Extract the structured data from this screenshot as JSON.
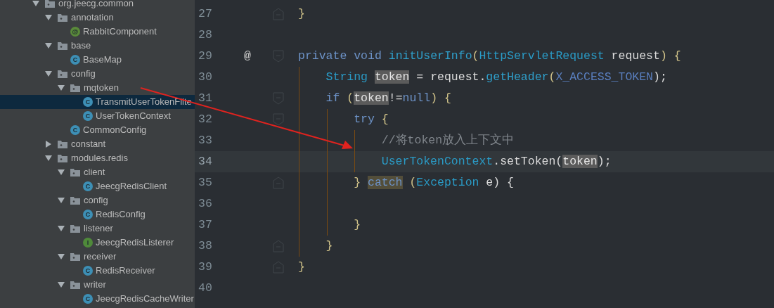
{
  "project_tree": [
    {
      "label": "org.jeecg.common",
      "kind": "package",
      "expanded": true,
      "selected": false,
      "children": [
        {
          "label": "annotation",
          "kind": "package",
          "expanded": true,
          "selected": false,
          "children": [
            {
              "label": "RabbitComponent",
              "kind": "annotation",
              "badge": "@",
              "selected": false
            }
          ]
        },
        {
          "label": "base",
          "kind": "package",
          "expanded": true,
          "selected": false,
          "children": [
            {
              "label": "BaseMap",
              "kind": "class",
              "badge": "C",
              "selected": false
            }
          ]
        },
        {
          "label": "config",
          "kind": "package",
          "expanded": true,
          "selected": false,
          "children": [
            {
              "label": "mqtoken",
              "kind": "package",
              "expanded": true,
              "selected": false,
              "children": [
                {
                  "label": "TransmitUserTokenFilte",
                  "kind": "class",
                  "badge": "C",
                  "selected": true
                },
                {
                  "label": "UserTokenContext",
                  "kind": "class",
                  "badge": "C",
                  "selected": false
                }
              ]
            },
            {
              "label": "CommonConfig",
              "kind": "class",
              "badge": "C",
              "selected": false
            }
          ]
        },
        {
          "label": "constant",
          "kind": "package",
          "expanded": false,
          "selected": false
        },
        {
          "label": "modules.redis",
          "kind": "package",
          "expanded": true,
          "selected": false,
          "children": [
            {
              "label": "client",
              "kind": "package",
              "expanded": true,
              "selected": false,
              "children": [
                {
                  "label": "JeecgRedisClient",
                  "kind": "class",
                  "badge": "C",
                  "selected": false
                }
              ]
            },
            {
              "label": "config",
              "kind": "package",
              "expanded": true,
              "selected": false,
              "children": [
                {
                  "label": "RedisConfig",
                  "kind": "class",
                  "badge": "C",
                  "selected": false
                }
              ]
            },
            {
              "label": "listener",
              "kind": "package",
              "expanded": true,
              "selected": false,
              "children": [
                {
                  "label": "JeecgRedisListerer",
                  "kind": "interface",
                  "badge": "I",
                  "selected": false
                }
              ]
            },
            {
              "label": "receiver",
              "kind": "package",
              "expanded": true,
              "selected": false,
              "children": [
                {
                  "label": "RedisReceiver",
                  "kind": "class",
                  "badge": "C",
                  "selected": false
                }
              ]
            },
            {
              "label": "writer",
              "kind": "package",
              "expanded": true,
              "selected": false,
              "children": [
                {
                  "label": "JeecgRedisCacheWriter",
                  "kind": "class",
                  "badge": "C",
                  "selected": false
                }
              ]
            }
          ]
        }
      ]
    }
  ],
  "editor": {
    "lines": [
      {
        "number": "27",
        "current": false,
        "fold": {
          "kind": "end"
        },
        "tokens": [
          {
            "text": "}",
            "kind": "brace"
          }
        ]
      },
      {
        "number": "28",
        "current": false
      },
      {
        "number": "29",
        "current": false,
        "gutter_mark": "@",
        "fold": {
          "kind": "start"
        },
        "tokens": [
          {
            "text": "private void ",
            "kind": "keyword"
          },
          {
            "text": "initUserInfo",
            "kind": "method"
          },
          {
            "text": "(",
            "kind": "brace"
          },
          {
            "text": "HttpServletRequest",
            "kind": "type"
          },
          {
            "text": " request",
            "kind": "plain"
          },
          {
            "text": ") {",
            "kind": "brace"
          }
        ],
        "children": [
          {
            "number": "30",
            "current": false,
            "tokens": [
              {
                "text": "String ",
                "kind": "type"
              },
              {
                "text": "token",
                "kind": "usage"
              },
              {
                "text": " = request.",
                "kind": "plain"
              },
              {
                "text": "getHeader",
                "kind": "method"
              },
              {
                "text": "(",
                "kind": "brace"
              },
              {
                "text": "X_ACCESS_TOKEN",
                "kind": "constant"
              },
              {
                "text": ");",
                "kind": "plain"
              }
            ]
          },
          {
            "number": "31",
            "current": false,
            "fold": {
              "kind": "start"
            },
            "tokens": [
              {
                "text": "if",
                "kind": "keyword"
              },
              {
                "text": " (",
                "kind": "brace"
              },
              {
                "text": "token",
                "kind": "usage"
              },
              {
                "text": "!=",
                "kind": "plain"
              },
              {
                "text": "null",
                "kind": "keyword"
              },
              {
                "text": ") {",
                "kind": "brace"
              }
            ],
            "children": [
              {
                "number": "32",
                "current": false,
                "fold": {
                  "kind": "start"
                },
                "tokens": [
                  {
                    "text": "try",
                    "kind": "keyword"
                  },
                  {
                    "text": " {",
                    "kind": "brace"
                  }
                ],
                "children": [
                  {
                    "number": "33",
                    "current": false,
                    "tokens": [
                      {
                        "text": "//将token放入上下文中",
                        "kind": "comment"
                      }
                    ]
                  },
                  {
                    "number": "34",
                    "current": true,
                    "tokens": [
                      {
                        "text": "UserTokenContext",
                        "kind": "type"
                      },
                      {
                        "text": ".setToken(",
                        "kind": "plain"
                      },
                      {
                        "text": "token",
                        "kind": "usage"
                      },
                      {
                        "text": ");",
                        "kind": "plain"
                      }
                    ]
                  }
                ]
              },
              {
                "number": "35",
                "current": false,
                "fold": {
                  "kind": "end"
                },
                "tokens": [
                  {
                    "text": "} ",
                    "kind": "brace"
                  },
                  {
                    "text": "catch",
                    "kind": "match"
                  },
                  {
                    "text": " (",
                    "kind": "brace"
                  },
                  {
                    "text": "Exception",
                    "kind": "type"
                  },
                  {
                    "text": " e) {",
                    "kind": "plain"
                  }
                ],
                "children": [
                  {
                    "number": "36",
                    "current": false
                  }
                ]
              },
              {
                "number": "37",
                "current": false,
                "tokens": [
                  {
                    "text": "}",
                    "kind": "brace"
                  }
                ]
              }
            ]
          },
          {
            "number": "38",
            "current": false,
            "fold": {
              "kind": "end"
            },
            "tokens": [
              {
                "text": "}",
                "kind": "brace"
              }
            ]
          }
        ]
      },
      {
        "number": "39",
        "current": false,
        "fold": {
          "kind": "end"
        },
        "tokens": [
          {
            "text": "}",
            "kind": "brace"
          }
        ]
      },
      {
        "number": "40",
        "current": false
      }
    ]
  }
}
